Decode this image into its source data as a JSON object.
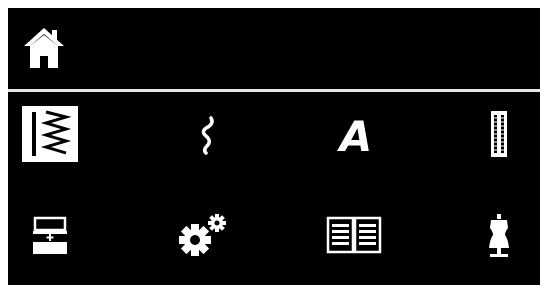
{
  "header": {
    "home_icon": "home-icon"
  },
  "menu": {
    "selected_index": 0,
    "items": [
      {
        "icon": "practical-stitches-icon",
        "selected": true
      },
      {
        "icon": "decorative-stitches-icon",
        "selected": false
      },
      {
        "icon": "alphabets-icon",
        "selected": false
      },
      {
        "icon": "buttonholes-icon",
        "selected": false
      },
      {
        "icon": "personal-program-icon",
        "selected": false
      },
      {
        "icon": "setup-program-icon",
        "selected": false
      },
      {
        "icon": "tutorial-book-icon",
        "selected": false
      },
      {
        "icon": "sewing-consultant-icon",
        "selected": false
      }
    ],
    "alphabet_glyph": "A"
  },
  "colors": {
    "background": "#000000",
    "foreground": "#ffffff",
    "divider": "#e6e6e6",
    "selected_fill": "#ffffff",
    "selected_icon": "#000000"
  }
}
